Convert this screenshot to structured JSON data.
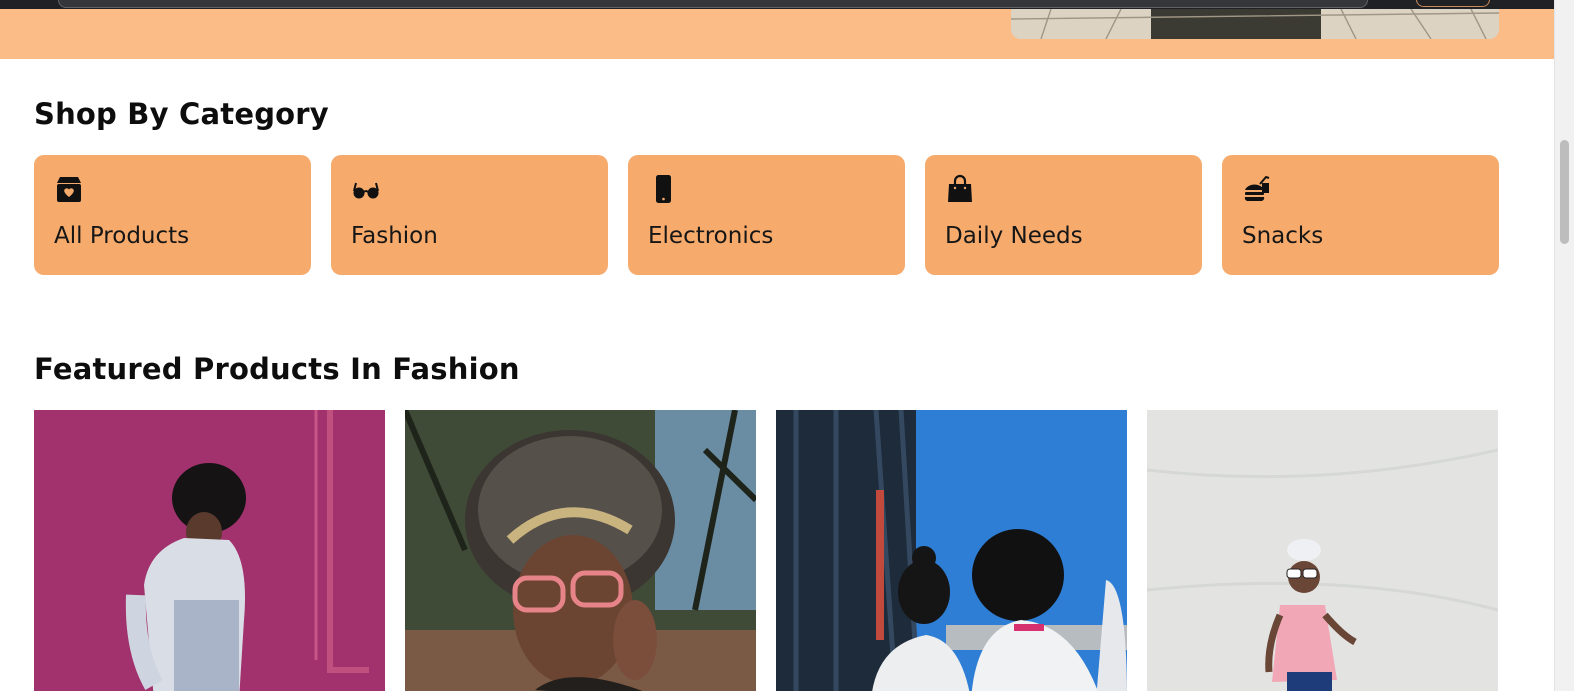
{
  "sections": {
    "categories_title": "Shop By Category",
    "featured_title": "Featured Products In Fashion"
  },
  "categories": [
    {
      "label": "All Products",
      "icon": "box-heart-icon"
    },
    {
      "label": "Fashion",
      "icon": "glasses-icon"
    },
    {
      "label": "Electronics",
      "icon": "phone-icon"
    },
    {
      "label": "Daily Needs",
      "icon": "shopping-bag-icon"
    },
    {
      "label": "Snacks",
      "icon": "burger-soda-icon"
    }
  ],
  "colors": {
    "hero_band": "#fbbc87",
    "category_card": "#f6ab6c",
    "heading_text": "#0d0d0d"
  },
  "featured_products": [
    {
      "image": "product-photo-magenta-wall"
    },
    {
      "image": "product-photo-pink-glasses"
    },
    {
      "image": "product-photo-blue-sky"
    },
    {
      "image": "product-photo-white-wall"
    }
  ]
}
